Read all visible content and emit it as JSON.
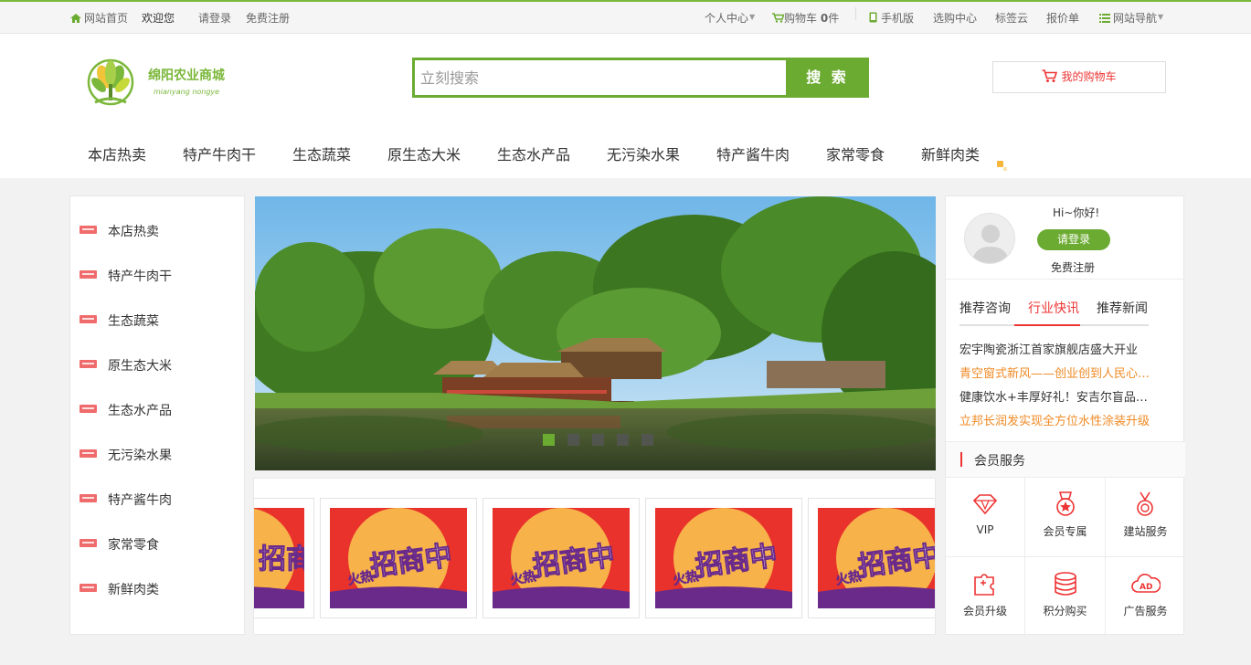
{
  "topbar": {
    "home": "网站首页",
    "welcome": "欢迎您",
    "login": "请登录",
    "register": "免费注册",
    "user_center": "个人中心",
    "cart_prefix": "购物车",
    "cart_count": "0",
    "cart_suffix": "件",
    "mobile": "手机版",
    "purchase": "选购中心",
    "tag_cloud": "标签云",
    "quote": "报价单",
    "site_nav": "网站导航"
  },
  "logo": {
    "name": "绵阳农业商城",
    "sub": "mianyang nongye"
  },
  "search": {
    "placeholder": "立刻搜索",
    "button": "搜 索"
  },
  "cart_button": "我的购物车",
  "nav": [
    "本店热卖",
    "特产牛肉干",
    "生态蔬菜",
    "原生态大米",
    "生态水产品",
    "无污染水果",
    "特产酱牛肉",
    "家常零食",
    "新鲜肉类"
  ],
  "categories": [
    "本店热卖",
    "特产牛肉干",
    "生态蔬菜",
    "原生态大米",
    "生态水产品",
    "无污染水果",
    "特产酱牛肉",
    "家常零食",
    "新鲜肉类"
  ],
  "banner": {
    "slides_total": 5,
    "active_slide": 1
  },
  "promo": {
    "text_small": "火热",
    "text_big": "招商中"
  },
  "user_panel": {
    "greeting": "Hi~你好!",
    "login": "请登录",
    "register": "免费注册"
  },
  "news_tabs": [
    "推荐咨询",
    "行业快讯",
    "推荐新闻"
  ],
  "active_tab": 1,
  "news": [
    {
      "text": "宏宇陶瓷浙江首家旗舰店盛大开业",
      "highlight": false
    },
    {
      "text": "青空窗式新风——创业创到人民心里去",
      "highlight": true
    },
    {
      "text": "健康饮水+丰厚好礼！安吉尔盲品测试",
      "highlight": false
    },
    {
      "text": "立邦长润发实现全方位水性涂装升级",
      "highlight": true
    }
  ],
  "services": {
    "title": "会员服务",
    "items": [
      "VIP",
      "会员专属",
      "建站服务",
      "会员升级",
      "积分购买",
      "广告服务"
    ]
  },
  "colors": {
    "brand_green": "#6cab32",
    "accent_red": "#e33333",
    "news_orange": "#f08a24"
  }
}
